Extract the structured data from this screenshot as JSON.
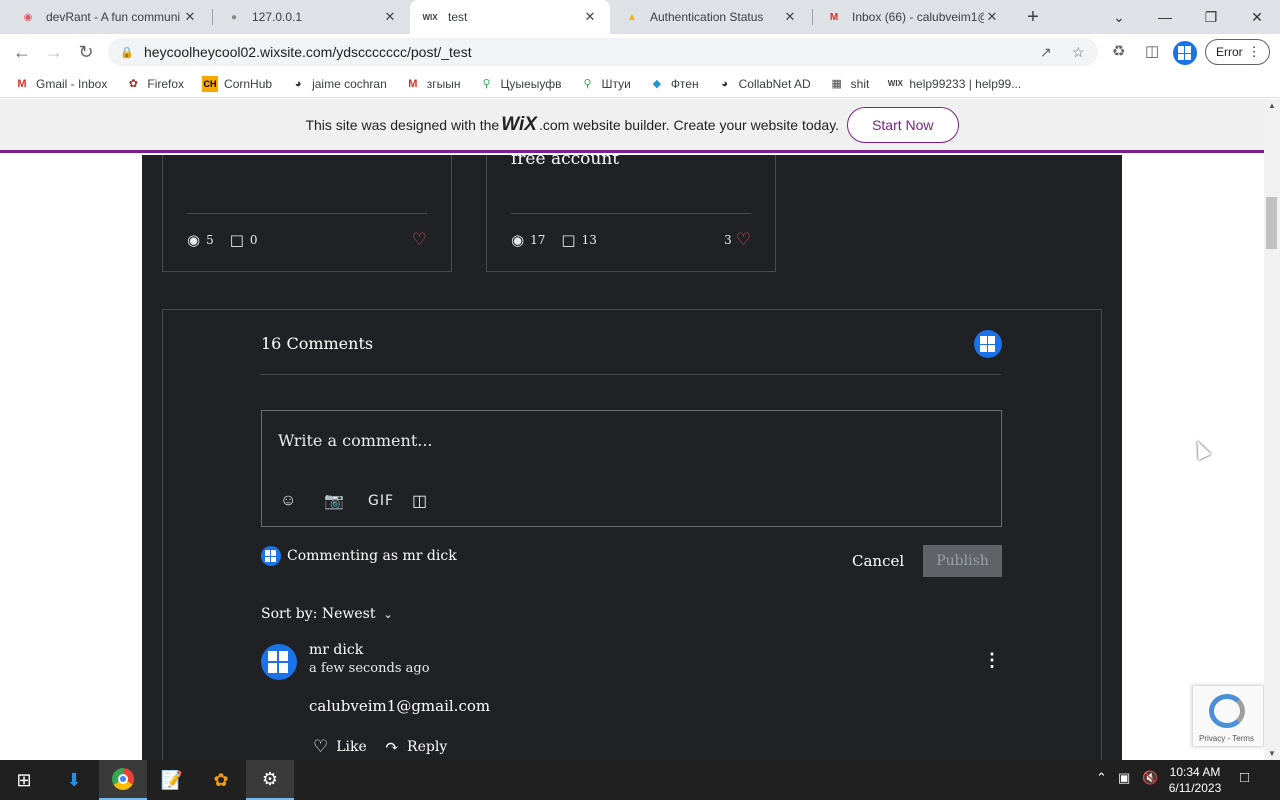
{
  "browser": {
    "tabs": [
      {
        "title": "devRant - A fun communi",
        "favicon": "devrant-icon"
      },
      {
        "title": "127.0.0.1",
        "favicon": "globe-icon"
      },
      {
        "title": "test",
        "favicon": "wix-icon",
        "favicon_text": "WIX"
      },
      {
        "title": "Authentication Status",
        "favicon": "drive-icon"
      },
      {
        "title": "Inbox (66) - calubveim1@",
        "favicon": "gmail-icon"
      }
    ],
    "url": "heycoolheycool02.wixsite.com/ydsccccccc/post/_test",
    "error_label": "Error",
    "bookmarks": [
      {
        "label": "Gmail - Inbox",
        "icon": "gmail-icon"
      },
      {
        "label": "Firefox",
        "icon": "firefox-icon"
      },
      {
        "label": "CornHub",
        "icon": "cornhub-icon"
      },
      {
        "label": "jaime cochran",
        "icon": "globe-icon"
      },
      {
        "label": "згыын",
        "icon": "gmail-icon"
      },
      {
        "label": "Цуыеыуфв",
        "icon": "maps-pin-icon"
      },
      {
        "label": "Штуи",
        "icon": "maps-pin-icon"
      },
      {
        "label": "Фтен",
        "icon": "diamond-icon"
      },
      {
        "label": "CollabNet AD",
        "icon": "globe-icon"
      },
      {
        "label": "shit",
        "icon": "server-icon"
      },
      {
        "label": "help99233 | help99...",
        "icon": "wix-icon"
      }
    ]
  },
  "wix_banner": {
    "text_before": "This site was designed with the",
    "logo": "WiX",
    "text_after": ".com website builder. Create your website today.",
    "cta": "Start Now"
  },
  "post_cards": [
    {
      "title": "",
      "views": "5",
      "comments": "0",
      "likes": ""
    },
    {
      "title": "free account",
      "views": "17",
      "comments": "13",
      "likes": "3"
    }
  ],
  "comments_section": {
    "heading": "16 Comments",
    "placeholder": "Write a comment...",
    "gif_label": "GIF",
    "commenting_as": "Commenting as mr dick",
    "cancel_label": "Cancel",
    "publish_label": "Publish",
    "sort_label": "Sort by: Newest",
    "items": [
      {
        "author": "mr dick",
        "time": "a few seconds ago",
        "text": "calubveim1@gmail.com",
        "like_label": "Like",
        "reply_label": "Reply"
      }
    ]
  },
  "recaptcha": {
    "text": "Privacy - Terms"
  },
  "taskbar": {
    "time": "10:34 AM",
    "date": "6/11/2023"
  },
  "colors": {
    "dark_panel": "#202124",
    "wix_purple": "#7e1f8c",
    "heart": "#e0535f",
    "avatar_blue": "#1a73e8"
  }
}
